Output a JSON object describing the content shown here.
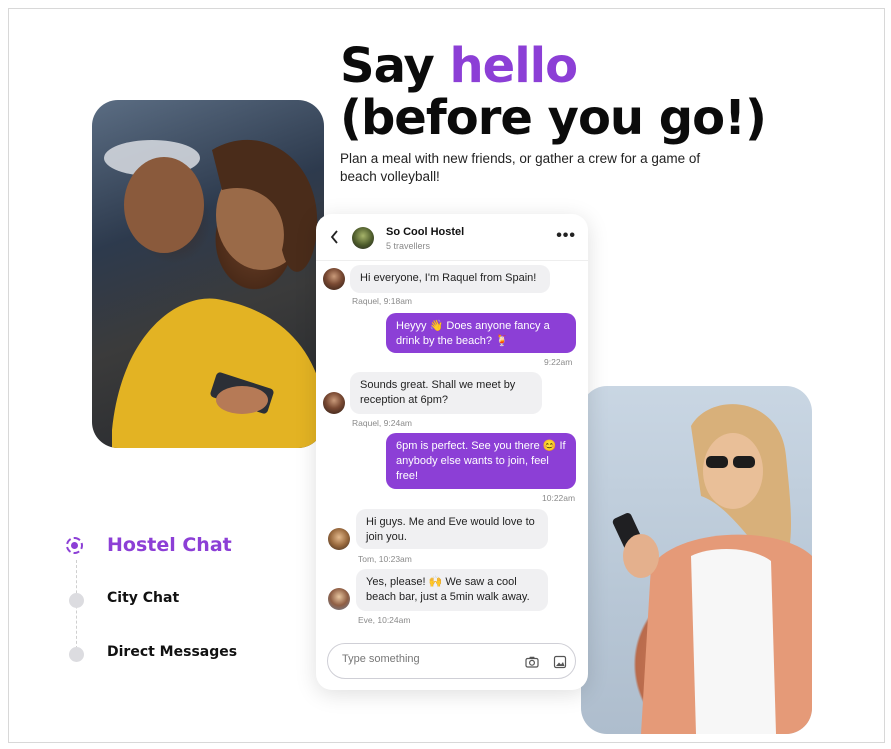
{
  "hero": {
    "title_part1": "Say ",
    "title_accent": "hello",
    "title_line2": "(before you go!)",
    "subtitle": "Plan a meal with new friends, or gather a crew for a game of beach volleyball!"
  },
  "chat": {
    "back_icon": "chevron-left-icon",
    "group_name": "So Cool Hostel",
    "group_count": "5 travellers",
    "more_icon": "more-horizontal-icon",
    "messages": [
      {
        "direction": "in",
        "text": "Hi everyone, I'm Raquel from Spain!",
        "meta": "Raquel, 9:18am",
        "avatar": "raquel"
      },
      {
        "direction": "out",
        "text": "Heyyy 👋 Does anyone fancy a drink by the beach? 🍹",
        "meta": "9:22am"
      },
      {
        "direction": "in",
        "text": "Sounds great. Shall we meet by reception at 6pm?",
        "meta": "Raquel, 9:24am",
        "avatar": "raquel"
      },
      {
        "direction": "out",
        "text": "6pm is perfect. See you there 😊 If anybody else wants to join, feel free!",
        "meta": "10:22am"
      },
      {
        "direction": "in",
        "text": "Hi guys. Me and Eve would love to join you.",
        "meta": "Tom, 10:23am",
        "avatar": "tom"
      },
      {
        "direction": "in",
        "text": "Yes, please! 🙌 We saw a cool beach bar, just a 5min walk away.",
        "meta": "Eve, 10:24am",
        "avatar": "eve"
      }
    ],
    "composer_placeholder": "Type something",
    "camera_icon": "camera-icon",
    "image_icon": "image-icon"
  },
  "nav": {
    "items": [
      {
        "label": "Hostel Chat",
        "active": true
      },
      {
        "label": "City Chat",
        "active": false
      },
      {
        "label": "Direct Messages",
        "active": false
      }
    ]
  },
  "colors": {
    "accent": "#8c3fd6",
    "bubble_in": "#f0f0f2",
    "text": "#111111"
  }
}
